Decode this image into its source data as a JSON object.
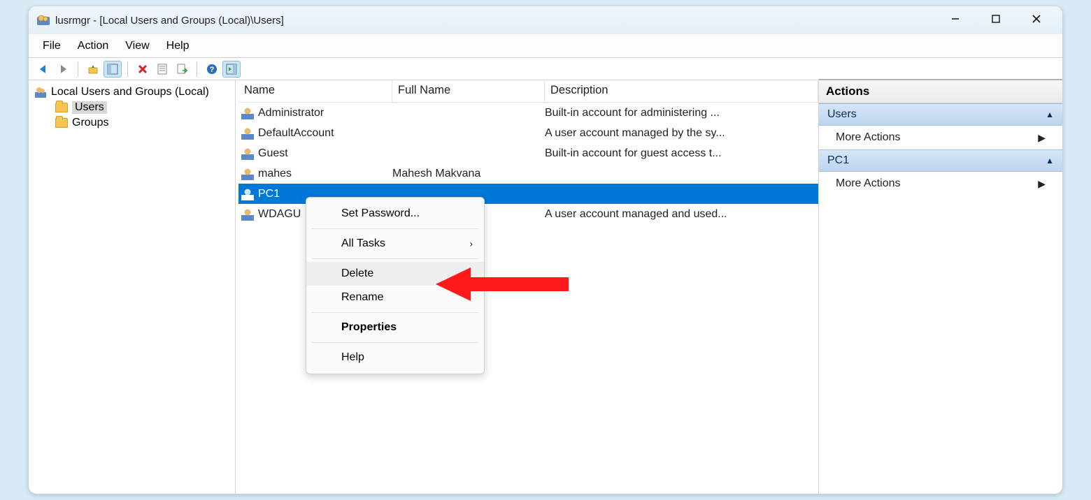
{
  "window": {
    "title": "lusrmgr - [Local Users and Groups (Local)\\Users]"
  },
  "menu": {
    "file": "File",
    "action": "Action",
    "view": "View",
    "help": "Help"
  },
  "tree": {
    "root": "Local Users and Groups (Local)",
    "users": "Users",
    "groups": "Groups"
  },
  "columns": {
    "name": "Name",
    "fullname": "Full Name",
    "description": "Description"
  },
  "users": [
    {
      "name": "Administrator",
      "fullname": "",
      "description": "Built-in account for administering ..."
    },
    {
      "name": "DefaultAccount",
      "fullname": "",
      "description": "A user account managed by the sy..."
    },
    {
      "name": "Guest",
      "fullname": "",
      "description": "Built-in account for guest access t..."
    },
    {
      "name": "mahes",
      "fullname": "Mahesh Makvana",
      "description": ""
    },
    {
      "name": "PC1",
      "fullname": "",
      "description": "",
      "selected": true
    },
    {
      "name": "WDAGU",
      "fullname": "",
      "description": "A user account managed and used..."
    }
  ],
  "context_menu": {
    "set_password": "Set Password...",
    "all_tasks": "All Tasks",
    "delete": "Delete",
    "rename": "Rename",
    "properties": "Properties",
    "help": "Help"
  },
  "actions": {
    "title": "Actions",
    "section_users": "Users",
    "more_actions": "More Actions",
    "section_item": "PC1"
  }
}
